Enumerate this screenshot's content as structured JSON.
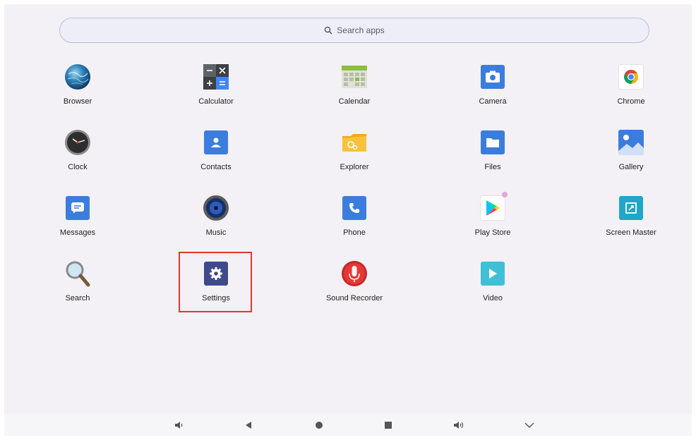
{
  "search": {
    "label": "Search apps"
  },
  "apps": [
    {
      "label": "Browser"
    },
    {
      "label": "Calculator"
    },
    {
      "label": "Calendar"
    },
    {
      "label": "Camera"
    },
    {
      "label": "Chrome"
    },
    {
      "label": "Clock"
    },
    {
      "label": "Contacts"
    },
    {
      "label": "Explorer"
    },
    {
      "label": "Files"
    },
    {
      "label": "Gallery"
    },
    {
      "label": "Messages"
    },
    {
      "label": "Music"
    },
    {
      "label": "Phone"
    },
    {
      "label": "Play Store"
    },
    {
      "label": "Screen Master"
    },
    {
      "label": "Search"
    },
    {
      "label": "Settings"
    },
    {
      "label": "Sound Recorder"
    },
    {
      "label": "Video"
    }
  ],
  "colors": {
    "highlight": "#e6362a",
    "blue": "#3b7ddd",
    "settings": "#3f4a8c",
    "video": "#3fc0d6"
  },
  "navbar": {
    "icons": [
      "volume-down-icon",
      "back-icon",
      "home-icon",
      "recents-icon",
      "volume-up-icon",
      "chevron-down-icon"
    ]
  }
}
